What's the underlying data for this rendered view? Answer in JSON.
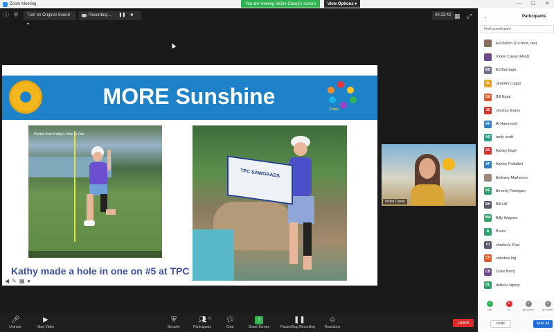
{
  "titlebar": {
    "title": "Zoom Meeting"
  },
  "banner": {
    "viewing_text": "You are viewing Vickie Casey's screen",
    "view_options_label": "View Options ▾"
  },
  "window_controls": {
    "minimize": "—",
    "maximize": "☐",
    "close": "✕"
  },
  "topbar": {
    "original_sound_label": "Turn on Original Sound ▾",
    "recording_label": "Recording...",
    "pause_glyph": "❚❚",
    "stop_glyph": "■",
    "timer": "00:23:42",
    "grid_glyph": "▦",
    "fullscreen_glyph": "⤢"
  },
  "slide": {
    "title": "MORE Sunshine",
    "club_text": "Rotary",
    "photo1_caption": "Photos from Kathy's Hole-in-One",
    "pennant_text": "TPC SAWGRASS",
    "caption": "Kathy made a hole in one on #5 at TPC"
  },
  "webcam": {
    "name": "Vickie Casey"
  },
  "toolbar": {
    "unmute": "Unmute",
    "stop_video": "Stop Video",
    "security": "Security",
    "participants": "Participants",
    "participants_count": "71",
    "chat": "Chat",
    "share_screen": "Share Screen",
    "pause_recording": "Pause/Stop Recording",
    "reactions": "Reactions",
    "leave": "Leave"
  },
  "panel": {
    "title": "Participants",
    "collapse_glyph": "⌄",
    "find_placeholder": "Find a participant",
    "participants": [
      {
        "name": "Ed Dalton (Co-host, me)",
        "initials": "",
        "color": "#8a6d5a"
      },
      {
        "name": "Vickie Casey (Host)",
        "initials": "",
        "color": "#6a4c8c"
      },
      {
        "name": "Ed Burnaga",
        "initials": "EB",
        "color": "#6b6f8a"
      },
      {
        "name": "Jennifer Logan",
        "initials": "JL",
        "color": "#e9a321"
      },
      {
        "name": "Bill Egan",
        "initials": "BE",
        "color": "#e55a2b"
      },
      {
        "name": "Jessica Evans",
        "initials": "JE",
        "color": "#d9322b"
      },
      {
        "name": "Al Hammock",
        "initials": "AH",
        "color": "#2f7fc6"
      },
      {
        "name": "andy scott",
        "initials": "AS",
        "color": "#2aa08a"
      },
      {
        "name": "Ashley Dopf",
        "initials": "AD",
        "color": "#d9322b"
      },
      {
        "name": "Ashley Folladori",
        "initials": "AF",
        "color": "#2f7fc6"
      },
      {
        "name": "Bethany Matheson",
        "initials": "",
        "color": "#9a8878"
      },
      {
        "name": "Beverly Flanegan",
        "initials": "BF",
        "color": "#2fa36b"
      },
      {
        "name": "Bill Hill",
        "initials": "BH",
        "color": "#555a70"
      },
      {
        "name": "Billy Wagner",
        "initials": "BW",
        "color": "#2fa36b"
      },
      {
        "name": "Bruce",
        "initials": "B",
        "color": "#2fa36b"
      },
      {
        "name": "charles's iPad",
        "initials": "CI",
        "color": "#555a70"
      },
      {
        "name": "christine hig",
        "initials": "CH",
        "color": "#e55a2b"
      },
      {
        "name": "Clare Berry",
        "initials": "CB",
        "color": "#6a4c8c"
      },
      {
        "name": "debra's laptop",
        "initials": "DL",
        "color": "#2fa36b"
      }
    ],
    "reactions": [
      {
        "label": "yes",
        "glyph": "✓",
        "color": "#2fb352"
      },
      {
        "label": "no",
        "glyph": "✕",
        "color": "#e02828"
      },
      {
        "label": "go slower",
        "glyph": "«",
        "color": "#888888"
      },
      {
        "label": "go faster",
        "glyph": "»",
        "color": "#888888"
      }
    ],
    "invite_label": "Invite",
    "mute_all_label": "Mute All"
  }
}
